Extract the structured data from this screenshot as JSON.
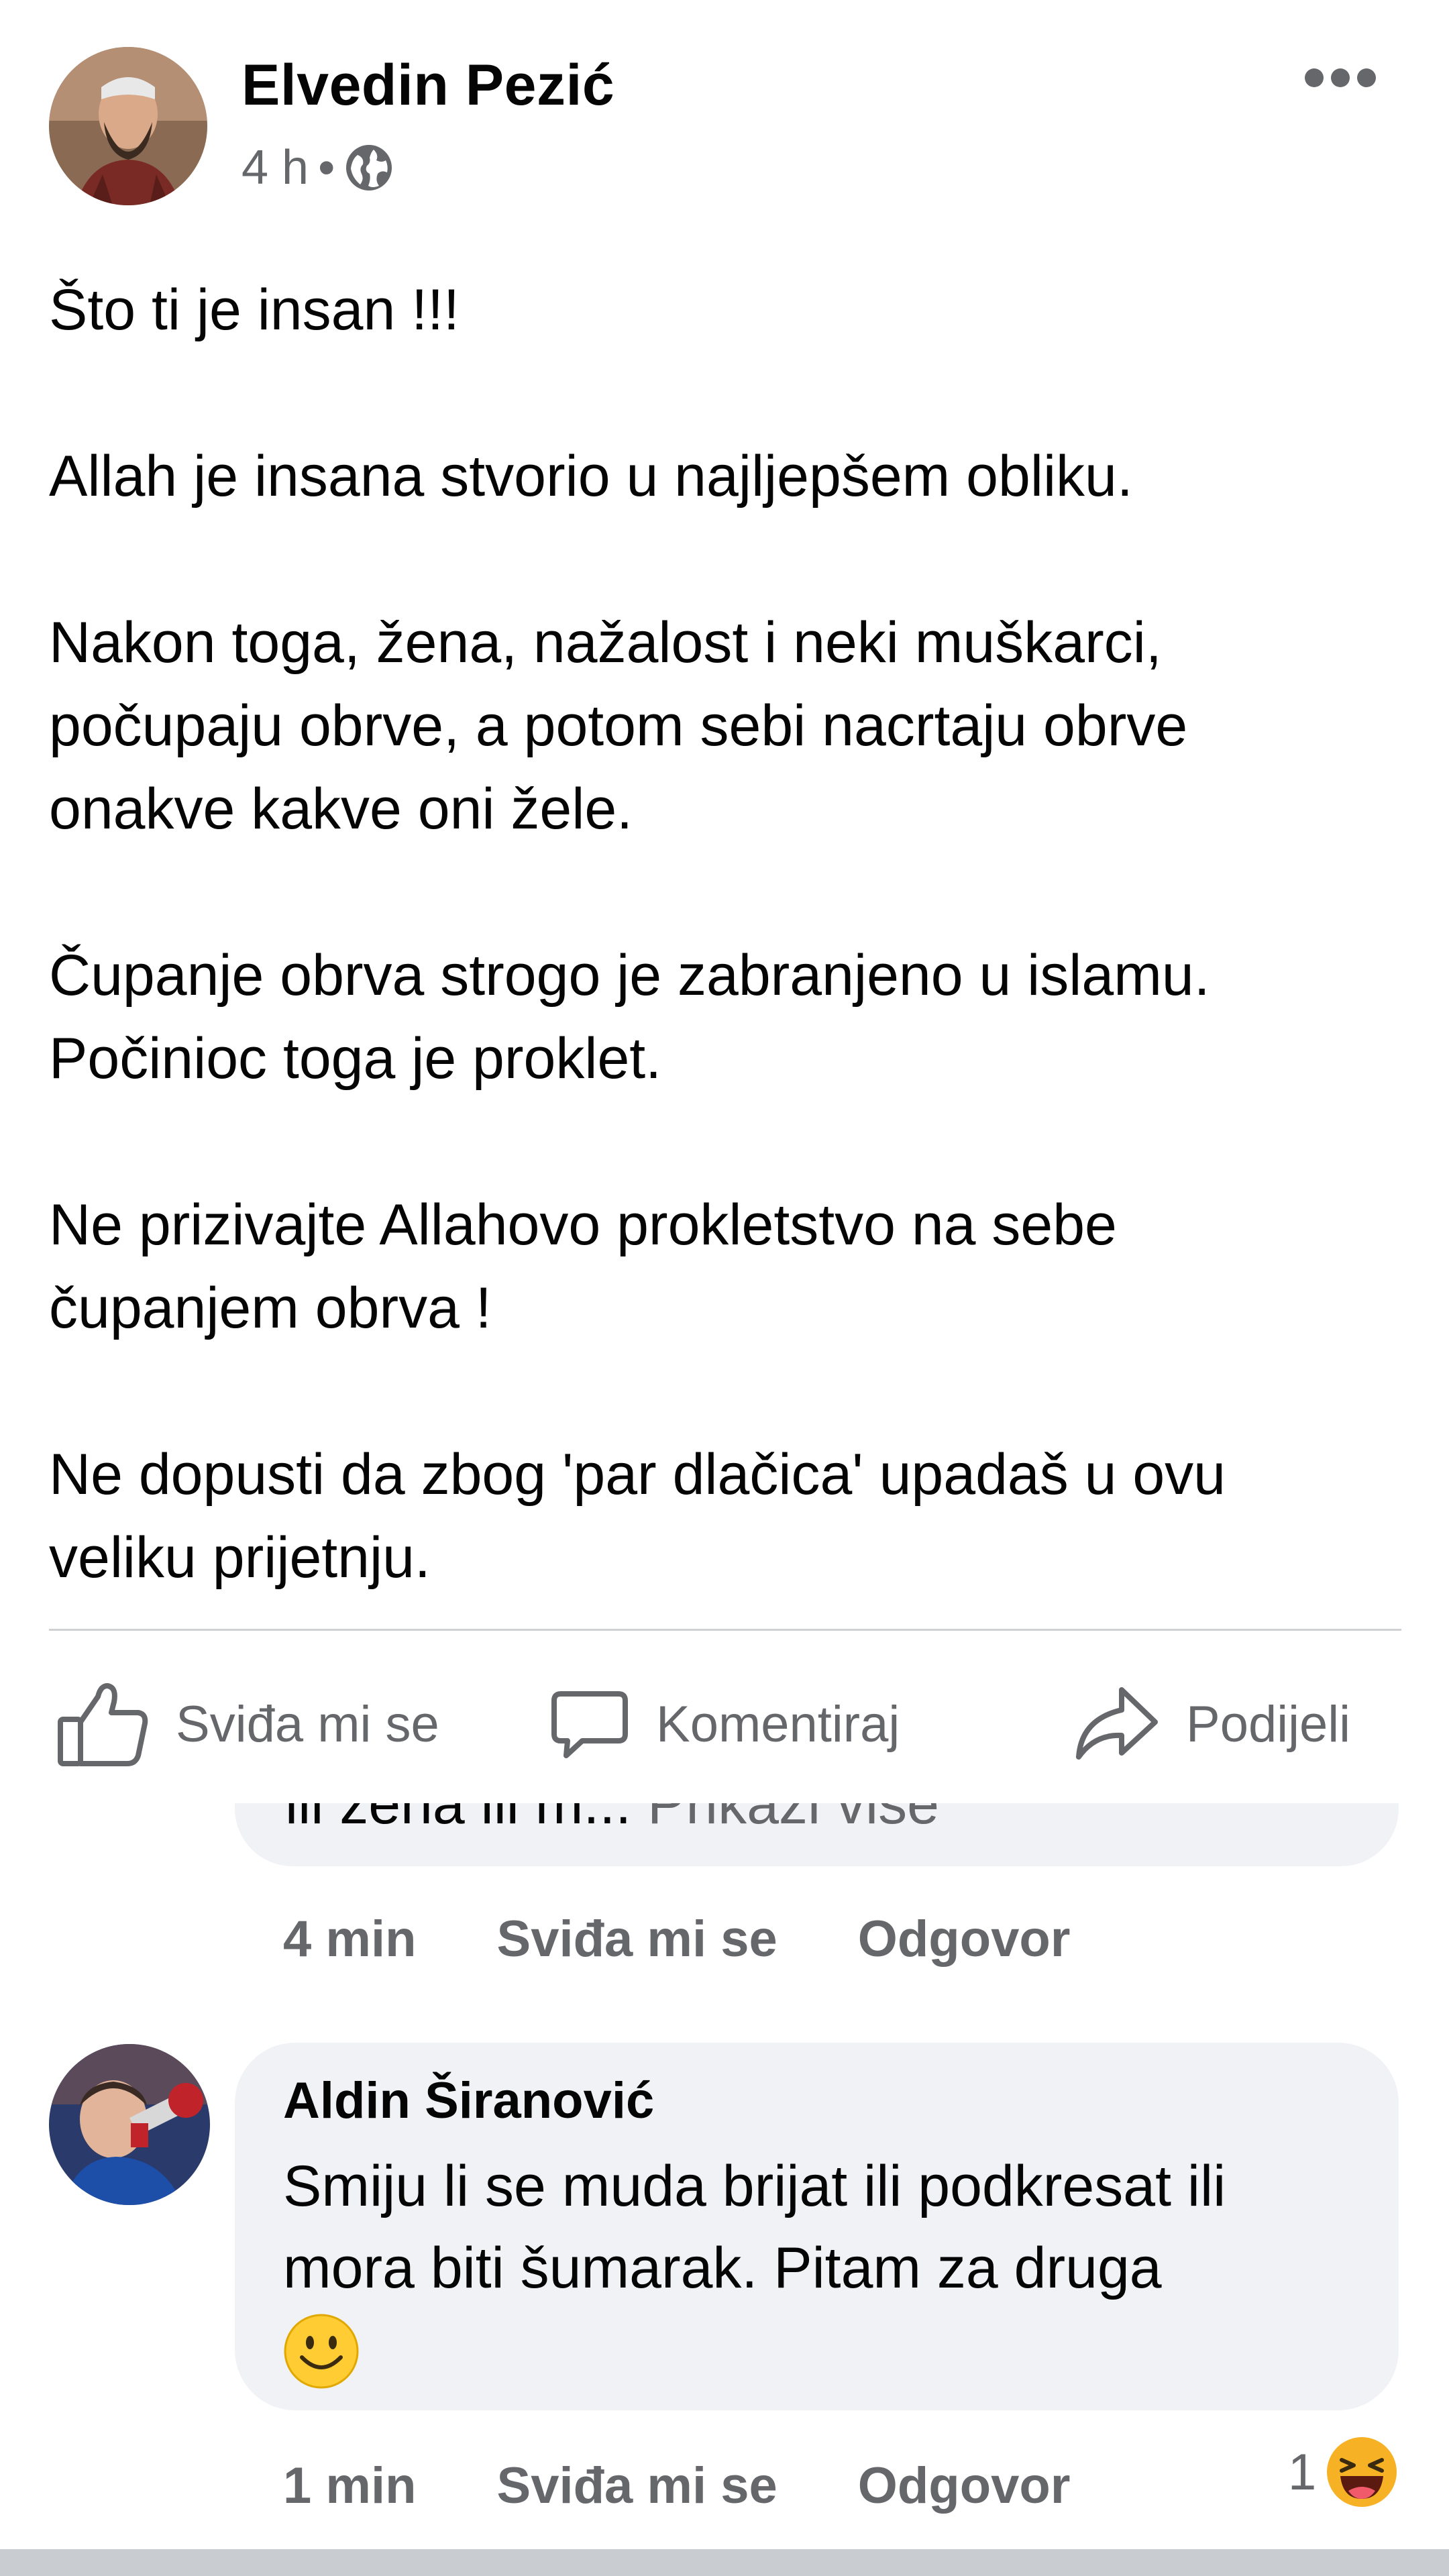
{
  "post": {
    "author": "Elvedin Pezić",
    "time": "4 h",
    "separator": "•",
    "audience_icon": "globe-icon",
    "more_icon": "more-dots-icon",
    "paragraphs": [
      "Što ti je insan !!!",
      "Allah je insana stvorio u najljepšem obliku.",
      "Nakon toga, žena, nažalost i neki muškarci,\npočupaju obrve, a potom sebi nacrtaju obrve\nonakve kakve oni žele.",
      "Čupanje obrva strogo je zabranjeno u islamu.\nPočinioc toga je proklet.",
      "Ne prizivajte Allahovo prokletstvo na sebe\nčupanjem obrva !",
      "Ne dopusti da zbog 'par dlačica' upadaš u ovu\nveliku prijetnju."
    ]
  },
  "actions": {
    "like": "Sviđa mi se",
    "comment": "Komentiraj",
    "share": "Podijeli"
  },
  "comments": [
    {
      "partial_text": "ili žena ili m...",
      "show_more": "Prikaži više",
      "time": "4 min",
      "like": "Sviđa mi se",
      "reply": "Odgovor"
    },
    {
      "author": "Aldin Širanović",
      "text": "Smiju li se muda brijat ili podkresat ili\nmora biti šumarak. Pitam za druga",
      "emoji": "smiling-face-icon",
      "time": "1 min",
      "like": "Sviđa mi se",
      "reply": "Odgovor",
      "reaction_count": "1",
      "reaction_icon": "laughing-reaction-icon"
    }
  ],
  "colors": {
    "text": "#050505",
    "secondary": "#65676b",
    "bubble": "#f0f2f5",
    "divider": "#ced0d4"
  }
}
